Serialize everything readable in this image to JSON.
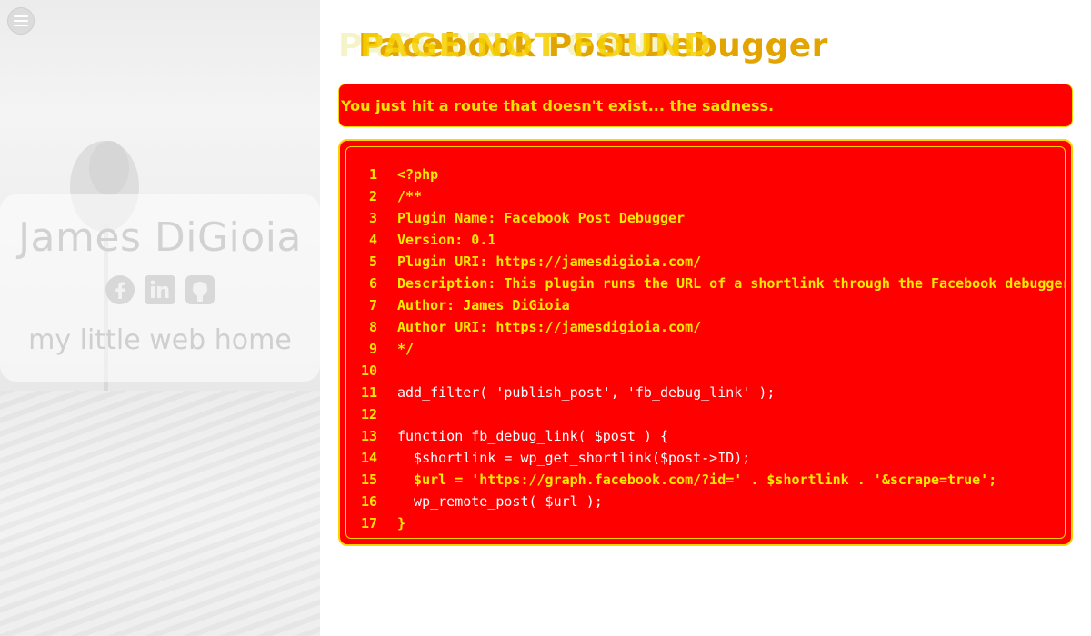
{
  "sidebar": {
    "profile_name": "James DiGioia",
    "tagline": "my little web home",
    "social": [
      {
        "icon": "facebook-icon"
      },
      {
        "icon": "linkedin-icon"
      },
      {
        "icon": "github-icon"
      }
    ]
  },
  "main": {
    "title_ghost": "PAGE NOT FOUND",
    "title": "Facebook Post Debugger",
    "title_overlay": "PAGE NOT FOUND",
    "alert_text": "You just hit a route that doesn't exist... the sadness.",
    "code_lines": [
      {
        "n": "1",
        "text": "<?php"
      },
      {
        "n": "2",
        "text": "/**"
      },
      {
        "n": "3",
        "text": "Plugin Name: Facebook Post Debugger"
      },
      {
        "n": "4",
        "text": "Version: 0.1"
      },
      {
        "n": "5",
        "text": "Plugin URI: https://jamesdigioia.com/"
      },
      {
        "n": "6",
        "text": "Description: This plugin runs the URL of a shortlink through the Facebook debugger"
      },
      {
        "n": "7",
        "text": "Author: James DiGioia"
      },
      {
        "n": "8",
        "text": "Author URI: https://jamesdigioia.com/"
      },
      {
        "n": "9",
        "text": "*/"
      },
      {
        "n": "10",
        "text": ""
      },
      {
        "n": "11",
        "text": "add_filter( 'publish_post', 'fb_debug_link' );"
      },
      {
        "n": "12",
        "text": ""
      },
      {
        "n": "13",
        "text": "function fb_debug_link( $post ) {"
      },
      {
        "n": "14",
        "text": "  $shortlink = wp_get_shortlink($post->ID);"
      },
      {
        "n": "15",
        "text": "  $url = 'https://graph.facebook.com/?id=' . $shortlink . '&scrape=true';"
      },
      {
        "n": "16",
        "text": "  wp_remote_post( $url );"
      },
      {
        "n": "17",
        "text": "}"
      }
    ]
  },
  "colors": {
    "accent": "#ff0000",
    "border": "#ffd200",
    "code_text": "#ffea00"
  }
}
